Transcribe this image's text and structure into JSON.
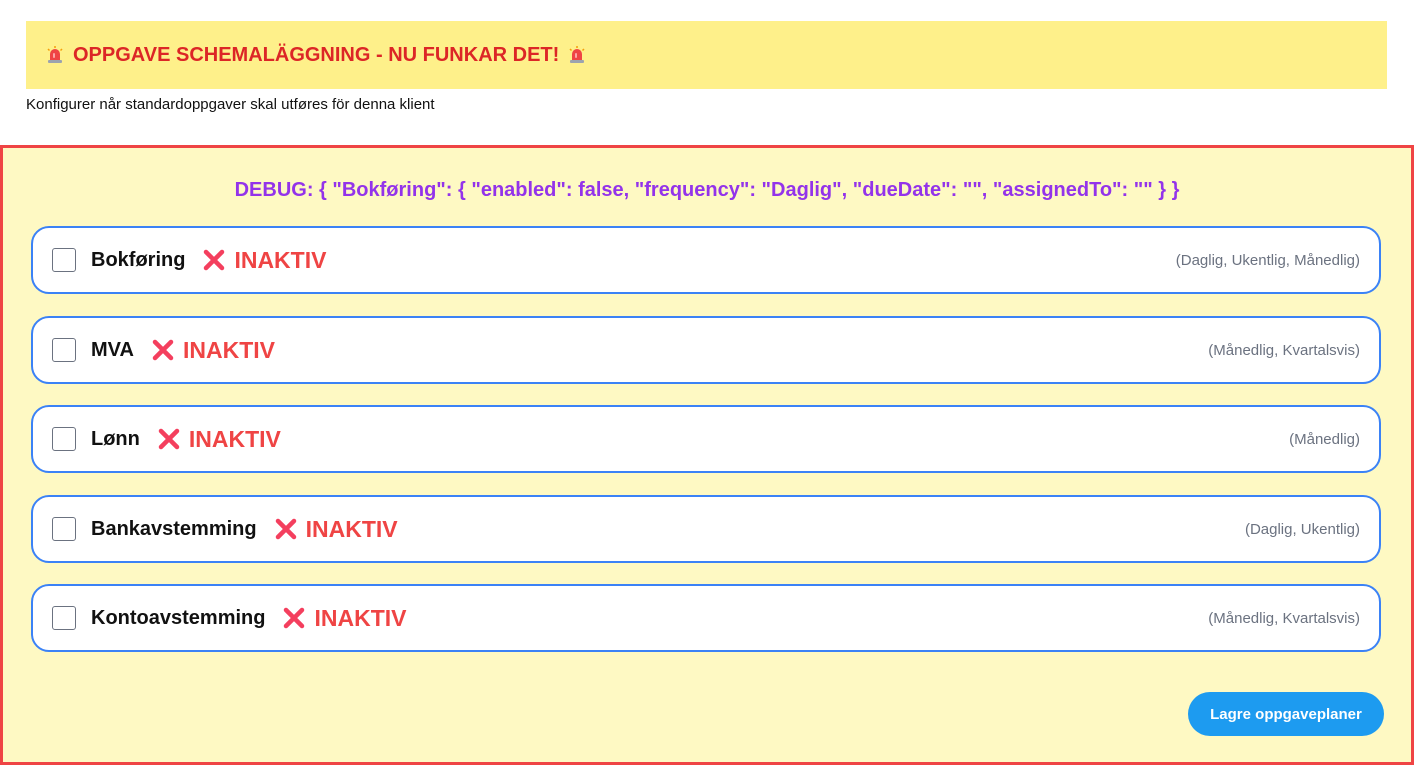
{
  "banner": {
    "title": "OPPGAVE SCHEMALÄGGNING - NU FUNKAR DET!"
  },
  "subtitle": "Konfigurer når standardoppgaver skal utføres för denna klient",
  "debug": "DEBUG: { \"Bokføring\": { \"enabled\": false, \"frequency\": \"Daglig\", \"dueDate\": \"\", \"assignedTo\": \"\" } }",
  "tasks": [
    {
      "name": "Bokføring",
      "status": "INAKTIV",
      "frequencies": "(Daglig, Ukentlig, Månedlig)",
      "checked": false
    },
    {
      "name": "MVA",
      "status": "INAKTIV",
      "frequencies": "(Månedlig, Kvartalsvis)",
      "checked": false
    },
    {
      "name": "Lønn",
      "status": "INAKTIV",
      "frequencies": "(Månedlig)",
      "checked": false
    },
    {
      "name": "Bankavstemming",
      "status": "INAKTIV",
      "frequencies": "(Daglig, Ukentlig)",
      "checked": false
    },
    {
      "name": "Kontoavstemming",
      "status": "INAKTIV",
      "frequencies": "(Månedlig, Kvartalsvis)",
      "checked": false
    }
  ],
  "save_button": "Lagre oppgaveplaner",
  "icons": {
    "banner": "siren-icon",
    "status": "cross-mark-icon"
  },
  "colors": {
    "banner_bg": "#fef08a",
    "banner_text": "#dc2626",
    "panel_bg": "#fef9c3",
    "panel_border": "#ef4444",
    "debug_text": "#9333ea",
    "row_border": "#3b82f6",
    "inactive": "#ef4444",
    "button": "#1d9bf0"
  }
}
